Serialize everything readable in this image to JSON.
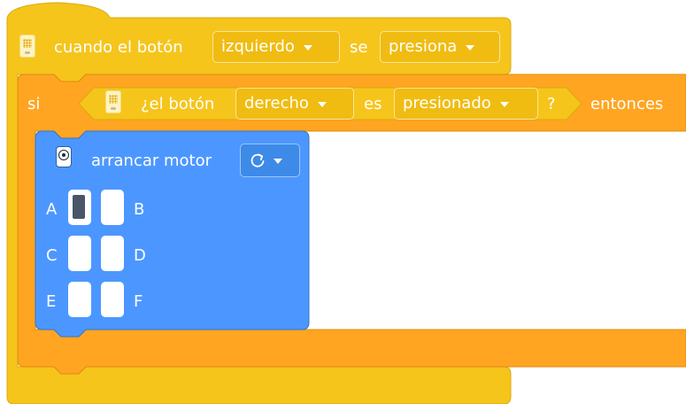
{
  "hat_block": {
    "when_label": "cuando el botón",
    "button_value": "izquierdo",
    "se_label": "se",
    "action_value": "presiona"
  },
  "if_block": {
    "si_label": "si",
    "condition": {
      "question_label": "¿el botón",
      "button_value": "derecho",
      "es_label": "es",
      "state_value": "presionado",
      "question_mark": "?"
    },
    "entonces_label": "entonces"
  },
  "motor_block": {
    "label": "arrancar motor",
    "direction_icon": "clockwise-arrow-icon",
    "ports": [
      {
        "name": "A",
        "selected": true
      },
      {
        "name": "B",
        "selected": false
      },
      {
        "name": "C",
        "selected": false
      },
      {
        "name": "D",
        "selected": false
      },
      {
        "name": "E",
        "selected": false
      },
      {
        "name": "F",
        "selected": false
      }
    ]
  },
  "colors": {
    "events_yellow": "#F5C51C",
    "control_orange": "#FFA521",
    "motor_blue": "#4C97FF"
  }
}
